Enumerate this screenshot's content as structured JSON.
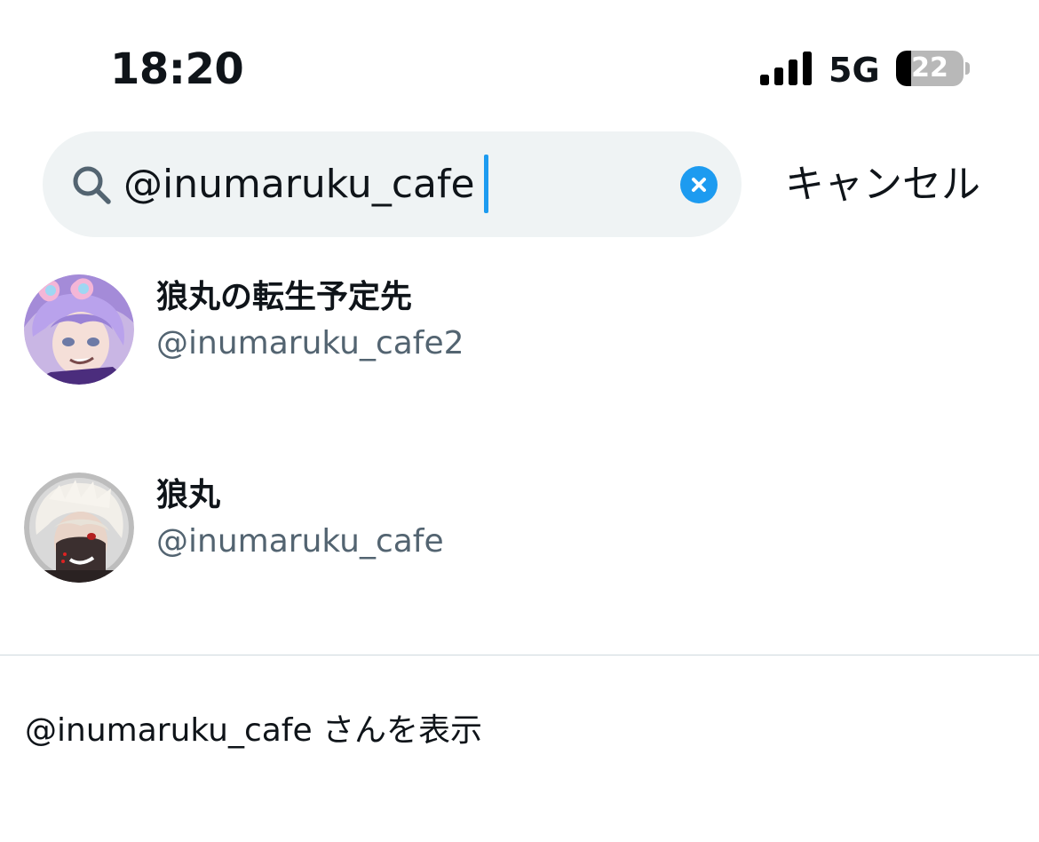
{
  "status_bar": {
    "time": "18:20",
    "network": "5G",
    "battery_level": "22",
    "signal_bars": 4
  },
  "search": {
    "query": "@inumaruku_cafe",
    "search_icon": "search-icon",
    "clear_icon": "close-icon",
    "cancel_label": "キャンセル",
    "accent_color": "#1d9bf0",
    "field_color": "#eff3f4"
  },
  "results": [
    {
      "name": "狼丸の転生予定先",
      "handle": "@inumaruku_cafe2",
      "avatar_icon": "avatar-purple-hair"
    },
    {
      "name": "狼丸",
      "handle": "@inumaruku_cafe",
      "avatar_icon": "avatar-white-hair"
    }
  ],
  "go_to_user": {
    "label": "@inumaruku_cafe さんを表示"
  },
  "colors": {
    "text_primary": "#0f1419",
    "text_secondary": "#536471",
    "divider": "#cfd9de"
  }
}
